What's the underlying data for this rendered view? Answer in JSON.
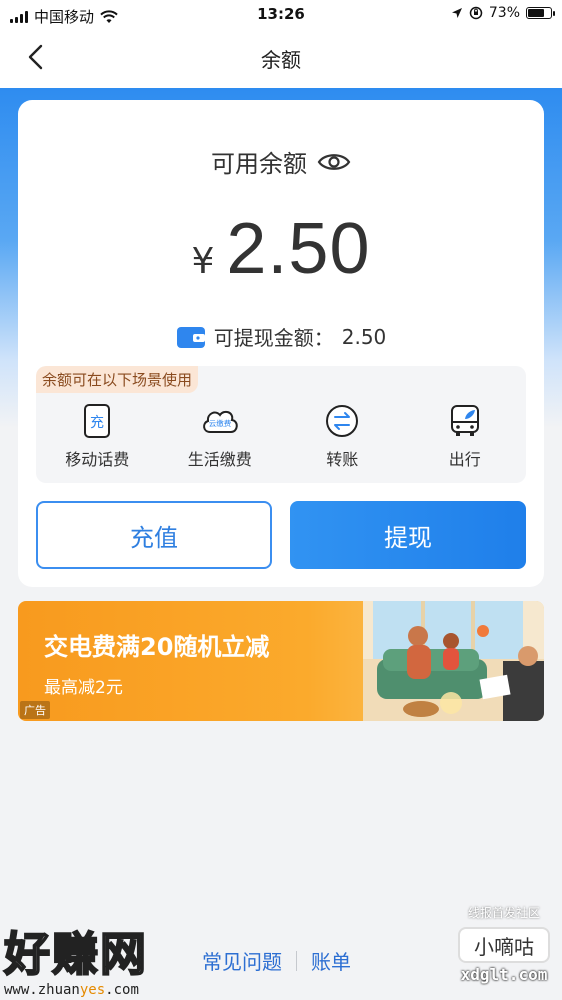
{
  "status_bar": {
    "carrier": "中国移动",
    "time": "13:26",
    "battery": "73%",
    "battery_level": 0.73
  },
  "nav": {
    "title": "余额"
  },
  "balance": {
    "available_label": "可用余额",
    "currency": "¥",
    "amount": "2.50",
    "withdrawable_label": "可提现金额：",
    "withdrawable_amount": "2.50"
  },
  "scenes": {
    "tag": "余额可在以下场景使用",
    "items": [
      {
        "label": "移动话费",
        "icon": "mobile-recharge-icon",
        "icon_text": "充"
      },
      {
        "label": "生活缴费",
        "icon": "utility-cloud-icon",
        "icon_text": "云缴费"
      },
      {
        "label": "转账",
        "icon": "transfer-icon"
      },
      {
        "label": "出行",
        "icon": "bus-icon"
      }
    ]
  },
  "actions": {
    "recharge": "充值",
    "withdraw": "提现"
  },
  "ad": {
    "title": "交电费满20随机立减",
    "subtitle": "最高减2元",
    "tag": "广告"
  },
  "footer": {
    "faq": "常见问题",
    "bill": "账单"
  },
  "watermarks": {
    "left_big": "好赚网",
    "left_small_a": "www.zhuan",
    "left_small_b": "yes",
    "left_small_c": ".com",
    "right_top": "线报首发社区",
    "right_mid": "小嘀咕",
    "right_bot": "xdglt.com"
  },
  "colors": {
    "primary": "#2f86ee",
    "link": "#2d6fd2",
    "ad_orange": "#f89a1e"
  }
}
